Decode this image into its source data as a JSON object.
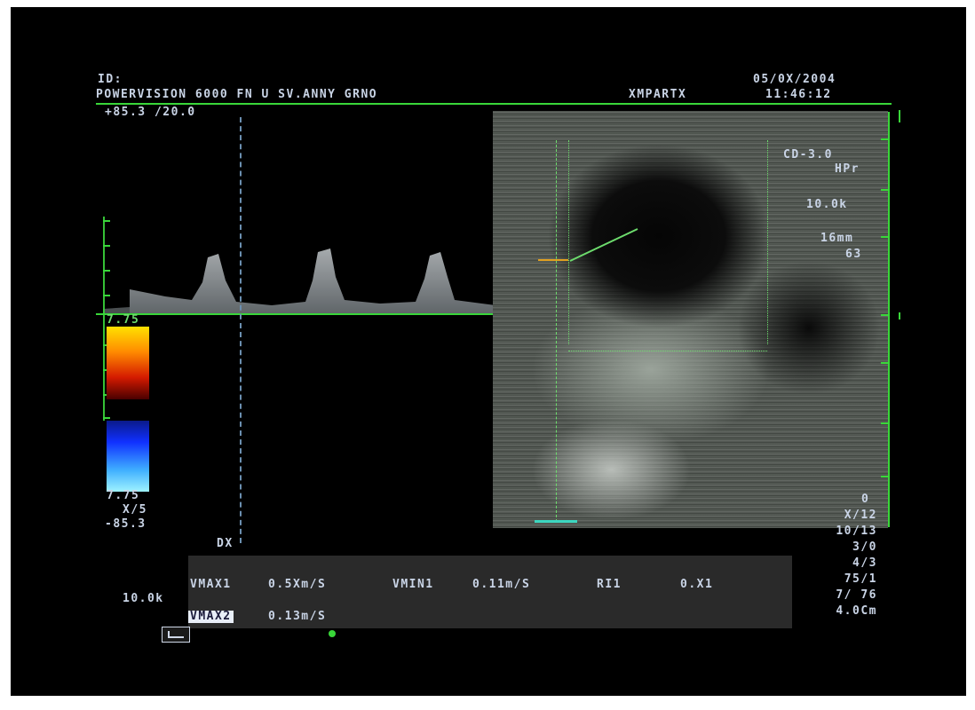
{
  "header": {
    "id_label": "ID:",
    "system_line": "POWERVISION 6000 FN U SV.ANNY GRNO",
    "preset": "XMPARTX",
    "date": "05/0X/2004",
    "time": "11:46:12"
  },
  "doppler": {
    "angle_label": "+85.3 /20.0",
    "scale_top": "7.75",
    "scale_bottom": "7.75",
    "scale_ratio": "X/5",
    "scale_neg": "-85.3",
    "marker": "DX",
    "prf": "10.0k",
    "color_map": {
      "top": "#ffe100",
      "mid": "#d41a00",
      "bottom_top": "#1030ff",
      "bottom_bot": "#9ff3ff"
    }
  },
  "image_side": {
    "label_cd": "CD-3.0",
    "label_hpr": "HPr",
    "freq": "10.0k",
    "depth": "16mm",
    "gain": "63",
    "zero": "0",
    "params": [
      "X/12",
      "10/13",
      "3/0",
      "4/3",
      "75/1",
      "7/ 76",
      "4.0Cm"
    ]
  },
  "measurements": {
    "vmax1_label": "VMAX1",
    "vmax1_value": "0.5Xm/S",
    "vmin1_label": "VMIN1",
    "vmin1_value": "0.11m/S",
    "ri1_label": "RI1",
    "ri1_value": "0.X1",
    "vmax2_label": "VMAX2",
    "vmax2_value": "0.13m/S"
  }
}
